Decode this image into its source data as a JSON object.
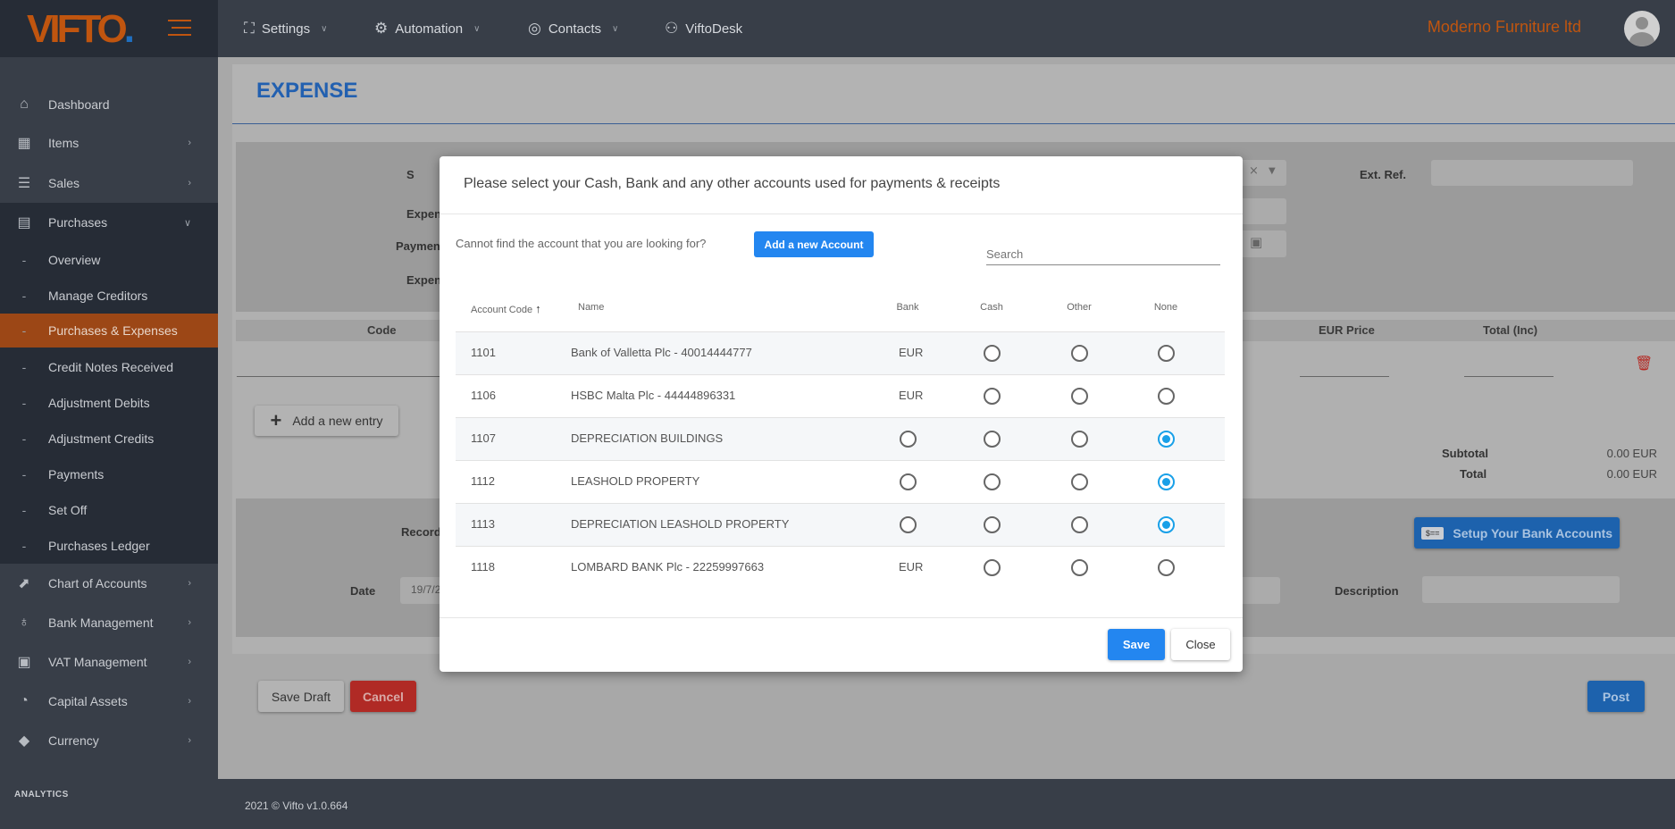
{
  "topbar": {
    "logo": "VIFTO",
    "nav": [
      {
        "label": "Settings",
        "icon": "sitemap-icon"
      },
      {
        "label": "Automation",
        "icon": "gear-icon"
      },
      {
        "label": "Contacts",
        "icon": "contacts-icon"
      },
      {
        "label": "ViftoDesk",
        "icon": "helpdesk-icon"
      }
    ],
    "company": "Moderno Furniture ltd",
    "accent": "#c0550f"
  },
  "sidebar": {
    "items": [
      {
        "label": "Dashboard",
        "icon": "home-icon"
      },
      {
        "label": "Items",
        "icon": "items-icon"
      },
      {
        "label": "Sales",
        "icon": "coins-icon"
      },
      {
        "label": "Purchases",
        "icon": "receipt-icon"
      }
    ],
    "sub_items": [
      "Overview",
      "Manage Creditors",
      "Purchases & Expenses",
      "Credit Notes Received",
      "Adjustment Debits",
      "Adjustment Credits",
      "Payments",
      "Set Off",
      "Purchases Ledger"
    ],
    "active": "Purchases & Expenses",
    "items2": [
      {
        "label": "Chart of Accounts",
        "icon": "chart-icon"
      },
      {
        "label": "Bank Management",
        "icon": "piggy-bank-icon"
      },
      {
        "label": "VAT Management",
        "icon": "clipboard-icon"
      },
      {
        "label": "Capital Assets",
        "icon": "assets-icon"
      },
      {
        "label": "Currency",
        "icon": "currency-icon"
      }
    ],
    "section": "ANALYTICS"
  },
  "page": {
    "title": "EXPENSE",
    "form": {
      "labels": [
        "S",
        "Expen",
        "Paymen",
        "Expen"
      ],
      "ext_ref_label": "Ext. Ref."
    },
    "table_headers": {
      "code": "Code",
      "eur_price": "EUR Price",
      "total_inc": "Total (Inc)"
    },
    "add_entry": "Add a new entry",
    "subtotal_label": "Subtotal",
    "subtotal_value": "0.00 EUR",
    "total_label": "Total",
    "total_value": "0.00 EUR",
    "record_label": "Record",
    "setup_bank": "Setup Your Bank Accounts",
    "date_label": "Date",
    "date_value": "19/7/2",
    "description_label": "Description",
    "save_draft": "Save Draft",
    "cancel": "Cancel",
    "post": "Post"
  },
  "footer": "2021 © Vifto v1.0.664",
  "modal": {
    "title": "Please select your Cash, Bank and any other accounts used for payments & receipts",
    "hint": "Cannot find the account that you are looking for?",
    "add_account": "Add a new Account",
    "search_placeholder": "Search",
    "columns": {
      "code": "Account Code",
      "name": "Name",
      "bank": "Bank",
      "cash": "Cash",
      "other": "Other",
      "none": "None"
    },
    "sort": "ascending",
    "rows": [
      {
        "code": "1101",
        "name": "Bank of Valletta Plc - 40014444777",
        "bank": "EUR",
        "selected": null
      },
      {
        "code": "1106",
        "name": "HSBC Malta Plc - 44444896331",
        "bank": "EUR",
        "selected": null
      },
      {
        "code": "1107",
        "name": "DEPRECIATION BUILDINGS",
        "bank": null,
        "selected": "none"
      },
      {
        "code": "1112",
        "name": "LEASHOLD PROPERTY",
        "bank": null,
        "selected": "none"
      },
      {
        "code": "1113",
        "name": "DEPRECIATION LEASHOLD PROPERTY",
        "bank": null,
        "selected": "none"
      },
      {
        "code": "1118",
        "name": "LOMBARD BANK Plc - 22259997663",
        "bank": "EUR",
        "selected": null
      }
    ],
    "save": "Save",
    "close": "Close",
    "primary_color": "#2386f0",
    "radio_color": "#19a0e8"
  }
}
